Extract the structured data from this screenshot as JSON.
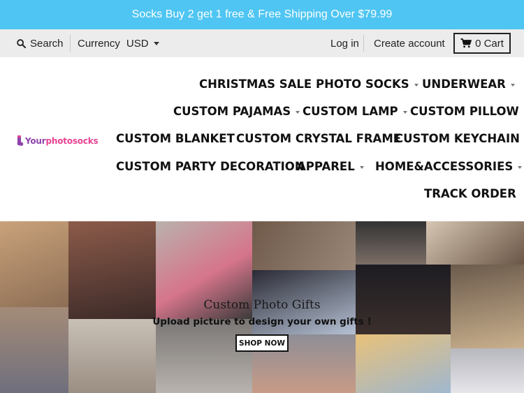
{
  "announcement": "Socks Buy 2 get 1 free & Free Shipping Over $79.99",
  "utility_bar": {
    "search_label": "Search",
    "currency_label": "Currency",
    "currency_value": "USD",
    "login_label": "Log in",
    "create_account_label": "Create account",
    "cart_label": "0 Cart"
  },
  "logo": {
    "part1": "Your",
    "part2": "photosocks"
  },
  "nav": {
    "christmas_sale": "CHRISTMAS SALE",
    "photo_socks": "PHOTO SOCKS",
    "underwear": "UNDERWEAR",
    "custom_pajamas": "CUSTOM PAJAMAS",
    "custom_lamp": "CUSTOM LAMP",
    "custom_pillow": "CUSTOM PILLOW",
    "custom_blanket": "CUSTOM BLANKET",
    "custom_crystal_frame": "CUSTOM CRYSTAL FRAME",
    "custom_keychain": "CUSTOM KEYCHAIN",
    "custom_party_decoration": "CUSTOM PARTY DECORATION",
    "apparel": "APPAREL",
    "home_accessories": "HOME&ACCESSORIES",
    "track_order": "TRACK ORDER"
  },
  "hero": {
    "title": "Custom Photo Gifts",
    "subtitle": "Upload picture to design your own gifts !",
    "button_label": "SHOP NOW"
  },
  "colors": {
    "announcement_bg": "#4ec5f2",
    "utility_bg": "#ececec",
    "logo_purple": "#8e44ad",
    "logo_pink": "#e84393"
  },
  "icons": [
    "search-icon",
    "cart-icon",
    "chevron-down-icon",
    "sock-logo-icon"
  ]
}
